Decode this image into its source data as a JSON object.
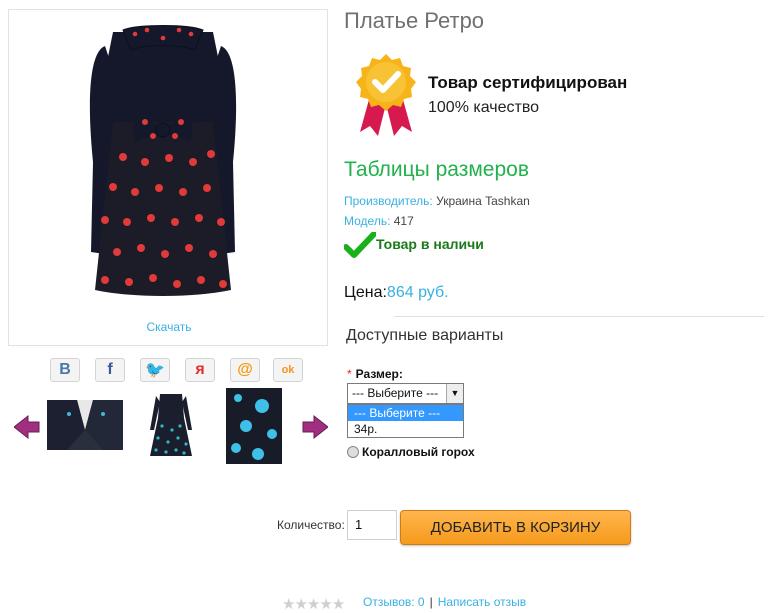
{
  "product": {
    "title": "Платье Ретро",
    "download_label": "Скачать",
    "certificate_title": "Товар сертифицирован",
    "certificate_sub": "100% качество",
    "size_tables_label": "Таблицы размеров",
    "manufacturer_label": "Производитель:",
    "manufacturer_value": "Украина Tashkan",
    "model_label": "Модель:",
    "model_value": "417",
    "stock_label": "Товар в наличи",
    "price_label": "Цена:",
    "price_value": "864 руб.",
    "variants_title": "Доступные варианты"
  },
  "social": [
    {
      "icon": "vk-icon",
      "glyph": "В",
      "color": "#4a76a8"
    },
    {
      "icon": "facebook-icon",
      "glyph": "f",
      "color": "#3b5998"
    },
    {
      "icon": "twitter-icon",
      "glyph": "🐦",
      "color": "#1da1f2"
    },
    {
      "icon": "moikrug-icon",
      "glyph": "я",
      "color": "#e62e2e"
    },
    {
      "icon": "mail-icon",
      "glyph": "@",
      "color": "#f39c12"
    },
    {
      "icon": "odnoklassniki-icon",
      "glyph": "ok",
      "color": "#f7931e"
    }
  ],
  "options": {
    "required_mark": "*",
    "size_label": "Размер:",
    "size_selected": "--- Выберите ---",
    "size_options": [
      "--- Выберите ---",
      "34р."
    ],
    "radio_label": "Коралловый горох"
  },
  "cart": {
    "quantity_label": "Количество:",
    "quantity_value": "1",
    "add_button": "ДОБАВИТЬ В КОРЗИНУ"
  },
  "reviews": {
    "stars": "★★★★★",
    "count_label": "Отзывов: 0",
    "separator": "|",
    "write_label": "Написать отзыв"
  },
  "colors": {
    "accent_blue": "#38b0e3",
    "accent_green": "#22b14c",
    "cart_orange": "#f59a1c"
  }
}
